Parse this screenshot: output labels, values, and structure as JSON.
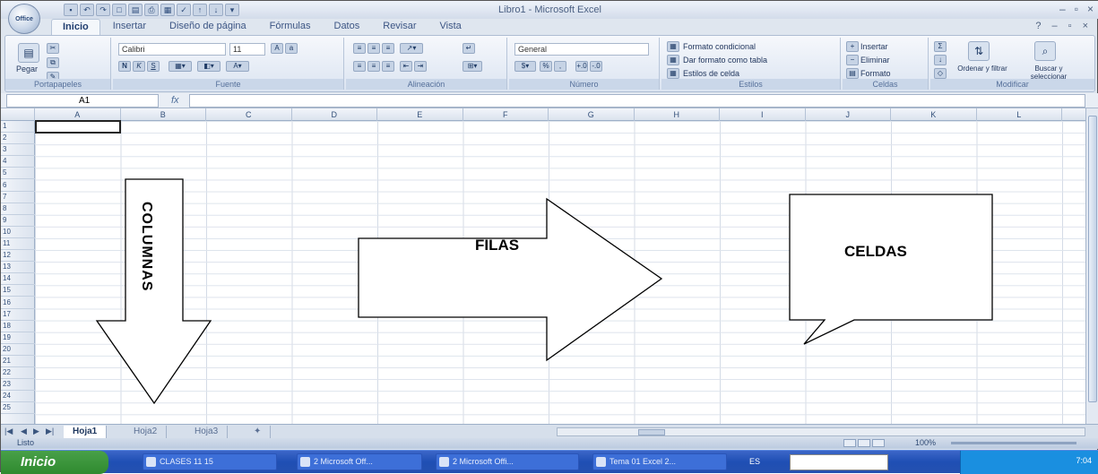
{
  "window": {
    "title": "Libro1 - Microsoft Excel",
    "office_button": "Office",
    "controls": [
      "–",
      "▫",
      "×"
    ],
    "help": [
      "?",
      "–",
      "▫",
      "×"
    ]
  },
  "ribbon_tabs": [
    "Inicio",
    "Insertar",
    "Diseño de página",
    "Fórmulas",
    "Datos",
    "Revisar",
    "Vista"
  ],
  "ribbon": {
    "portapapeles": {
      "label": "Portapapeles",
      "paste": "Pegar"
    },
    "fuente": {
      "label": "Fuente",
      "font": "Calibri",
      "size": "11"
    },
    "alineacion": {
      "label": "Alineación"
    },
    "numero": {
      "label": "Número",
      "format": "General"
    },
    "estilos": {
      "label": "Estilos",
      "items": [
        "Formato condicional",
        "Dar formato como tabla",
        "Estilos de celda"
      ]
    },
    "celdas": {
      "label": "Celdas",
      "items": [
        "Insertar",
        "Eliminar",
        "Formato"
      ]
    },
    "modificar": {
      "label": "Modificar",
      "sort": "Ordenar y filtrar",
      "find": "Buscar y seleccionar"
    }
  },
  "formula_bar": {
    "name_box": "A1",
    "fx": "fx",
    "value": ""
  },
  "columns": [
    "A",
    "B",
    "C",
    "D",
    "E",
    "F",
    "G",
    "H",
    "I",
    "J",
    "K",
    "L"
  ],
  "rows": [
    "1",
    "2",
    "3",
    "4",
    "5",
    "6",
    "7",
    "8",
    "9",
    "10",
    "11",
    "12",
    "13",
    "14",
    "15",
    "16",
    "17",
    "18",
    "19",
    "20",
    "21",
    "22",
    "23",
    "24",
    "25"
  ],
  "sheets": [
    "Hoja1",
    "Hoja2",
    "Hoja3"
  ],
  "active_sheet": "Hoja1",
  "status": {
    "text": "Listo",
    "zoom": "100%"
  },
  "taskbar": {
    "start": "Inicio",
    "tasks": [
      "CLASES 11 15",
      "2 Microsoft Off...",
      "2 Microsoft Offi...",
      "Tema 01 Excel 2..."
    ],
    "lang": "ES",
    "clock": "7:04"
  },
  "annotations": {
    "columnas": "COLUMNAS",
    "filas": "FILAS",
    "celdas": "CELDAS"
  }
}
